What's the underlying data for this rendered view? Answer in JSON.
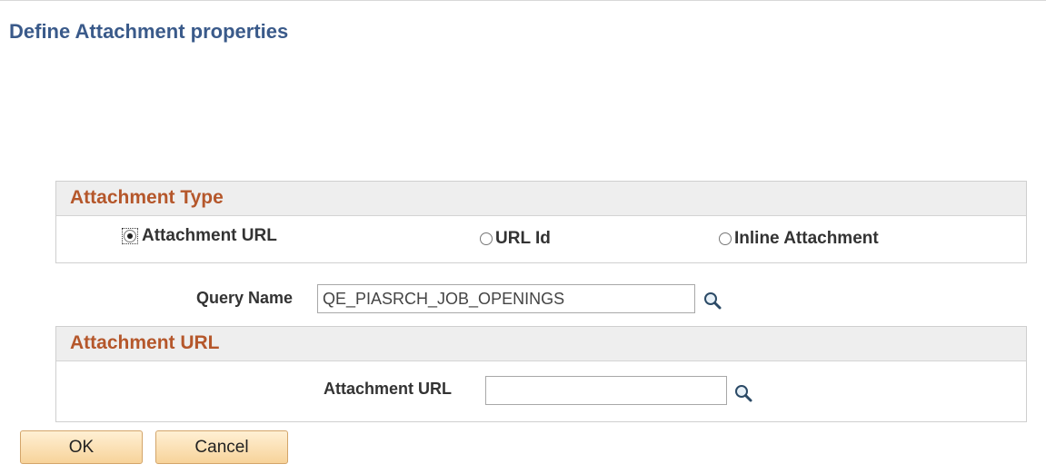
{
  "page": {
    "title": "Define Attachment properties"
  },
  "attachment_type": {
    "header": "Attachment Type",
    "options": [
      {
        "label": "Attachment URL",
        "selected": true
      },
      {
        "label": "URL Id",
        "selected": false
      },
      {
        "label": "Inline Attachment",
        "selected": false
      }
    ]
  },
  "query": {
    "label": "Query Name",
    "value": "QE_PIASRCH_JOB_OPENINGS",
    "lookup_icon": "magnifier-icon"
  },
  "attachment_url": {
    "header": "Attachment URL",
    "label": "Attachment URL",
    "value": "",
    "lookup_icon": "magnifier-icon"
  },
  "buttons": {
    "ok_label": "OK",
    "cancel_label": "Cancel"
  },
  "colors": {
    "title": "#3a5a8a",
    "section_header": "#b5572b",
    "button_border": "#d3a56a"
  }
}
